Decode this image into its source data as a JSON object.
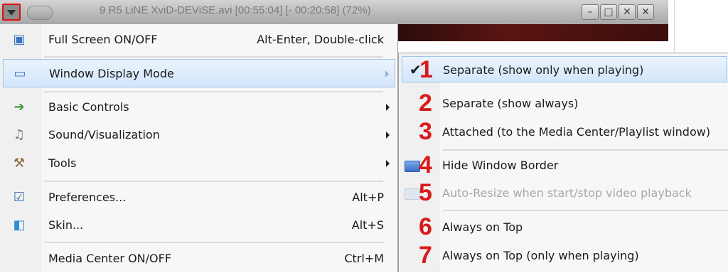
{
  "titlebar": {
    "title": "9 R5 LiNE XviD-DEViSE.avi [00:55:04] [- 00:20:58] (72%)",
    "buttons": [
      "minimize-icon",
      "restore-icon",
      "close-icon",
      "close-alt-icon"
    ]
  },
  "menu": {
    "items": [
      {
        "label": "Full Screen ON/OFF",
        "shortcut": "Alt-Enter, Double-click",
        "icon": "fullscreen-icon"
      },
      {
        "label": "Window Display Mode",
        "shortcut": "",
        "icon": "window-icon",
        "submenu": true,
        "highlighted": true
      },
      {
        "label": "Basic Controls",
        "shortcut": "",
        "icon": "controls-icon",
        "submenu": true
      },
      {
        "label": "Sound/Visualization",
        "shortcut": "",
        "icon": "sound-icon",
        "submenu": true
      },
      {
        "label": "Tools",
        "shortcut": "",
        "icon": "tools-icon",
        "submenu": true
      },
      {
        "label": "Preferences...",
        "shortcut": "Alt+P",
        "icon": "preferences-icon"
      },
      {
        "label": "Skin...",
        "shortcut": "Alt+S",
        "icon": "skin-icon"
      },
      {
        "label": "Media Center ON/OFF",
        "shortcut": "Ctrl+M",
        "icon": "media-center-icon"
      }
    ]
  },
  "submenu": {
    "items": [
      {
        "num": "1",
        "label": "Separate (show only when playing)",
        "checked": true,
        "highlighted": true
      },
      {
        "num": "2",
        "label": "Separate (show always)"
      },
      {
        "num": "3",
        "label": "Attached (to the Media Center/Playlist window)"
      },
      {
        "num": "4",
        "label": "Hide Window Border",
        "icon": "window-border-icon"
      },
      {
        "num": "5",
        "label": "Auto-Resize when start/stop video playback",
        "disabled": true,
        "icon": "auto-resize-icon"
      },
      {
        "num": "6",
        "label": "Always on Top"
      },
      {
        "num": "7",
        "label": "Always on Top (only when playing)"
      }
    ]
  },
  "colors": {
    "annotation": "#d91a1a",
    "highlight": "#d4e6fb"
  }
}
